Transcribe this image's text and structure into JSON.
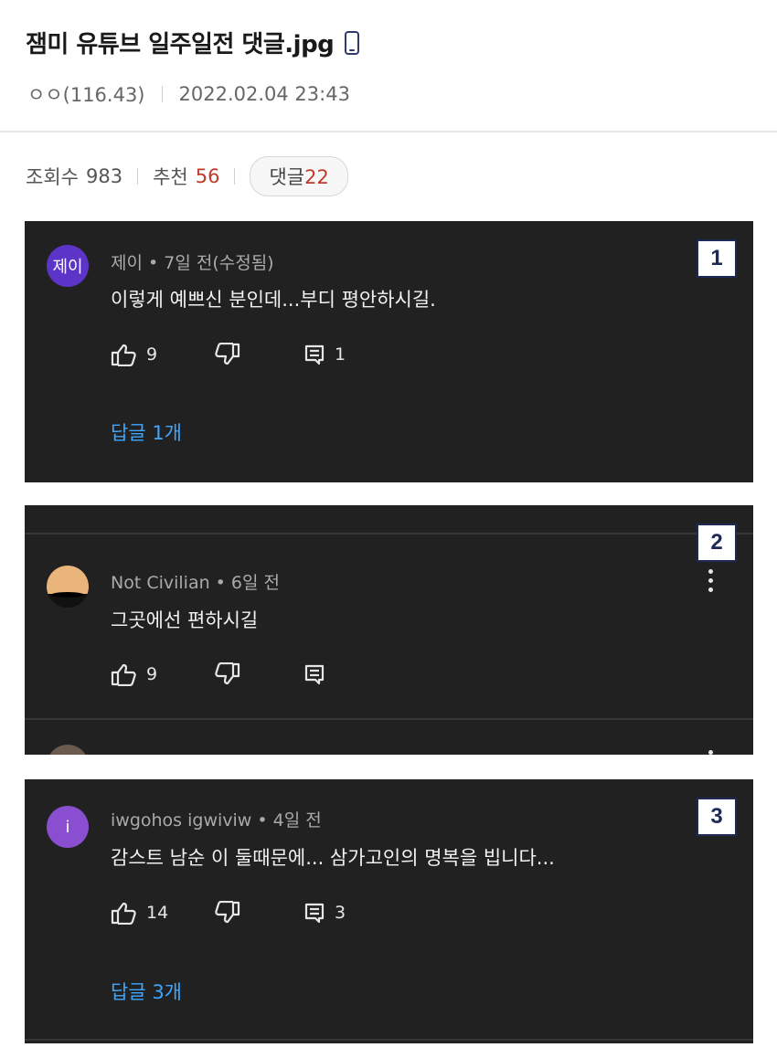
{
  "post": {
    "title": "잼미 유튜브 일주일전 댓글.jpg",
    "author": "ㅇㅇ(116.43)",
    "datetime": "2022.02.04 23:43",
    "views_label": "조회수",
    "views": "983",
    "recommend_label": "추천",
    "recommend": "56",
    "comments_label": "댓글",
    "comments": "22"
  },
  "screenshots": [
    {
      "badge": "1",
      "avatar_text": "제이",
      "avatar_color": "#5c35c8",
      "header": "제이 • 7일 전(수정됨)",
      "text": "이렇게 예쁘신 분인데...부디 평안하시길.",
      "likes": "9",
      "reply_count": "1",
      "replies_link": "답글 1개"
    },
    {
      "badge": "2",
      "avatar_text": "",
      "header": "Not Civilian • 6일 전",
      "text": "그곳에선 편하시길",
      "likes": "9",
      "reply_count": ""
    },
    {
      "badge": "3",
      "avatar_text": "i",
      "avatar_color": "#8a4fd0",
      "header": "iwgohos igwiviw • 4일 전",
      "text": "감스트 남순 이 둘때문에... 삼가고인의 명복을 빕니다...",
      "likes": "14",
      "reply_count": "3",
      "replies_link": "답글 3개"
    }
  ],
  "colors": {
    "comment_bg": "#212121",
    "reply_link": "#3ea6ff",
    "count_highlight": "#c0392b"
  }
}
